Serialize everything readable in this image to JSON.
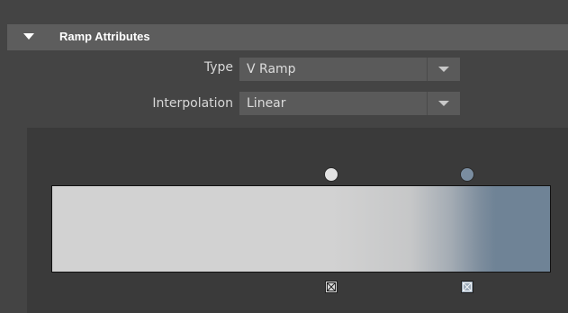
{
  "section": {
    "title": "Ramp Attributes"
  },
  "fields": {
    "type": {
      "label": "Type",
      "value": "V Ramp"
    },
    "interpolation": {
      "label": "Interpolation",
      "value": "Linear"
    }
  },
  "ramp": {
    "stops": [
      {
        "position": 0.56,
        "color": "#d2d2d2"
      },
      {
        "position": 0.84,
        "color": "#6f8396"
      }
    ]
  },
  "colors": {
    "panel_bg": "#444444",
    "header_bg": "#5d5d5d",
    "ramp_area_bg": "#3a3a3a"
  },
  "icons": {
    "section_toggle": "triangle-down-icon",
    "combo_arrow": "chevron-down-icon",
    "delete_marker": "x-box-icon"
  }
}
